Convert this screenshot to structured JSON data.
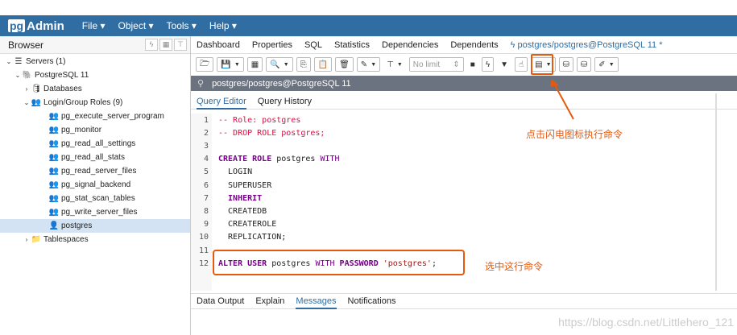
{
  "app": {
    "logo_pg": "pg",
    "logo_text": "Admin"
  },
  "menu": [
    {
      "label": "File"
    },
    {
      "label": "Object"
    },
    {
      "label": "Tools"
    },
    {
      "label": "Help"
    }
  ],
  "browser": {
    "title": "Browser",
    "tree": [
      {
        "label": "Servers (1)",
        "indent": 0,
        "arrow": "⌄",
        "icon": "☰"
      },
      {
        "label": "PostgreSQL 11",
        "indent": 1,
        "arrow": "⌄",
        "icon": "🐘"
      },
      {
        "label": "Databases",
        "indent": 2,
        "arrow": "›",
        "icon": "🛢"
      },
      {
        "label": "Login/Group Roles (9)",
        "indent": 2,
        "arrow": "⌄",
        "icon": "👥"
      },
      {
        "label": "pg_execute_server_program",
        "indent": 4,
        "arrow": "",
        "icon": "👥"
      },
      {
        "label": "pg_monitor",
        "indent": 4,
        "arrow": "",
        "icon": "👥"
      },
      {
        "label": "pg_read_all_settings",
        "indent": 4,
        "arrow": "",
        "icon": "👥"
      },
      {
        "label": "pg_read_all_stats",
        "indent": 4,
        "arrow": "",
        "icon": "👥"
      },
      {
        "label": "pg_read_server_files",
        "indent": 4,
        "arrow": "",
        "icon": "👥"
      },
      {
        "label": "pg_signal_backend",
        "indent": 4,
        "arrow": "",
        "icon": "👥"
      },
      {
        "label": "pg_stat_scan_tables",
        "indent": 4,
        "arrow": "",
        "icon": "👥"
      },
      {
        "label": "pg_write_server_files",
        "indent": 4,
        "arrow": "",
        "icon": "👥"
      },
      {
        "label": "postgres",
        "indent": 4,
        "arrow": "",
        "icon": "👤",
        "selected": true
      },
      {
        "label": "Tablespaces",
        "indent": 2,
        "arrow": "›",
        "icon": "📁"
      }
    ]
  },
  "tabs": [
    {
      "label": "Dashboard"
    },
    {
      "label": "Properties"
    },
    {
      "label": "SQL"
    },
    {
      "label": "Statistics"
    },
    {
      "label": "Dependencies"
    },
    {
      "label": "Dependents"
    },
    {
      "label": "ϟ postgres/postgres@PostgreSQL 11 *",
      "active": true
    }
  ],
  "toolbar": {
    "limit_label": "No limit",
    "exec_icon": "ϟ"
  },
  "connection": {
    "label": "postgres/postgres@PostgreSQL 11"
  },
  "subtabs": [
    {
      "label": "Query Editor",
      "active": true
    },
    {
      "label": "Query History"
    }
  ],
  "editor_lines": [
    {
      "n": "1",
      "segs": [
        {
          "t": "-- Role: postgres",
          "c": "cm"
        }
      ]
    },
    {
      "n": "2",
      "segs": [
        {
          "t": "-- DROP ROLE postgres;",
          "c": "cm"
        }
      ]
    },
    {
      "n": "3",
      "segs": []
    },
    {
      "n": "4",
      "segs": [
        {
          "t": "CREATE ROLE",
          "c": "kw"
        },
        {
          "t": " postgres ",
          "c": ""
        },
        {
          "t": "WITH",
          "c": "kw2"
        }
      ]
    },
    {
      "n": "5",
      "segs": [
        {
          "t": "  LOGIN",
          "c": ""
        }
      ]
    },
    {
      "n": "6",
      "segs": [
        {
          "t": "  SUPERUSER",
          "c": ""
        }
      ]
    },
    {
      "n": "7",
      "segs": [
        {
          "t": "  INHERIT",
          "c": "kw"
        }
      ]
    },
    {
      "n": "8",
      "segs": [
        {
          "t": "  CREATEDB",
          "c": ""
        }
      ]
    },
    {
      "n": "9",
      "segs": [
        {
          "t": "  CREATEROLE",
          "c": ""
        }
      ]
    },
    {
      "n": "10",
      "segs": [
        {
          "t": "  REPLICATION;",
          "c": ""
        }
      ]
    },
    {
      "n": "11",
      "segs": []
    },
    {
      "n": "12",
      "segs": [
        {
          "t": "ALTER USER",
          "c": "kw"
        },
        {
          "t": " postgres ",
          "c": ""
        },
        {
          "t": "WITH",
          "c": "kw2"
        },
        {
          "t": " PASSWORD ",
          "c": "kw"
        },
        {
          "t": "'postgres'",
          "c": "str"
        },
        {
          "t": ";",
          "c": ""
        }
      ]
    }
  ],
  "annotations": {
    "exec_note": "点击闪电图标执行命令",
    "select_note": "选中这行命令"
  },
  "bottomtabs": [
    {
      "label": "Data Output"
    },
    {
      "label": "Explain"
    },
    {
      "label": "Messages",
      "active": true
    },
    {
      "label": "Notifications"
    }
  ],
  "watermark": "https://blog.csdn.net/Littlehero_121"
}
